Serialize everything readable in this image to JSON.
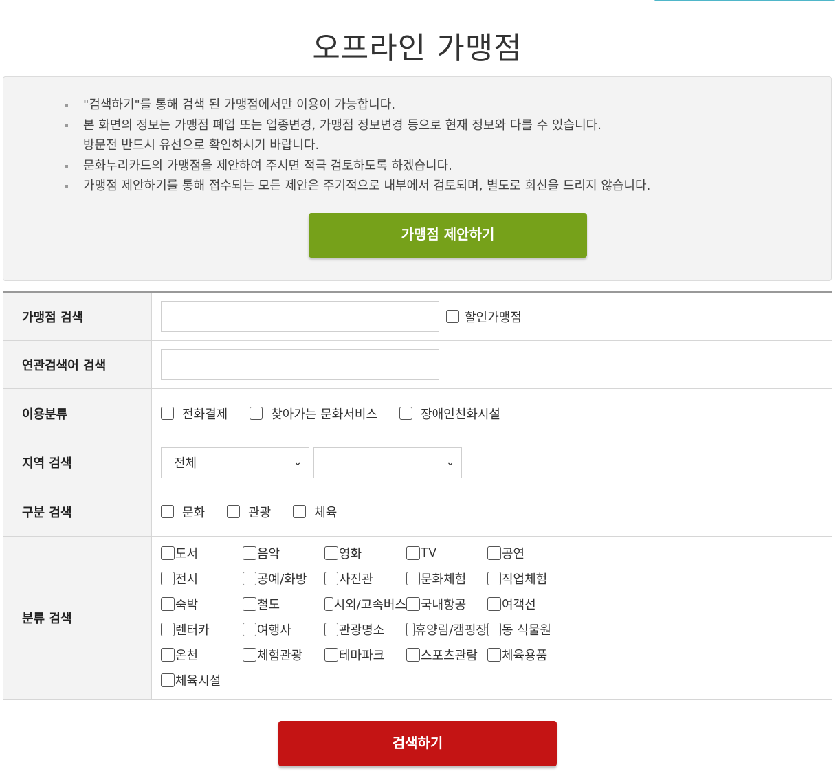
{
  "page": {
    "title": "오프라인 가맹점"
  },
  "notice": {
    "items": [
      {
        "lines": [
          "\"검색하기\"를 통해 검색 된 가맹점에서만 이용이 가능합니다."
        ]
      },
      {
        "lines": [
          "본 화면의 정보는 가맹점 폐업 또는 업종변경, 가맹점 정보변경 등으로 현재 정보와 다를 수 있습니다.",
          "방문전 반드시 유선으로 확인하시기 바랍니다."
        ]
      },
      {
        "lines": [
          "문화누리카드의 가맹점을 제안하여 주시면 적극 검토하도록 하겠습니다."
        ]
      },
      {
        "lines": [
          "가맹점 제안하기를 통해 접수되는 모든 제안은 주기적으로 내부에서 검토되며, 별도로 회신을 드리지 않습니다."
        ]
      }
    ],
    "suggest_button": "가맹점 제안하기"
  },
  "form": {
    "store_search": {
      "label": "가맹점 검색",
      "value": "",
      "discount_label": "할인가맹점",
      "discount_checked": false
    },
    "keyword_search": {
      "label": "연관검색어 검색",
      "value": ""
    },
    "usage_type": {
      "label": "이용분류",
      "options": [
        "전화결제",
        "찾아가는 문화서비스",
        "장애인친화시설"
      ]
    },
    "region_search": {
      "label": "지역 검색",
      "select1": "전체",
      "select2": ""
    },
    "division_search": {
      "label": "구분 검색",
      "options": [
        "문화",
        "관광",
        "체육"
      ]
    },
    "category_search": {
      "label": "분류 검색",
      "options": [
        "도서",
        "음악",
        "영화",
        "TV",
        "공연",
        "전시",
        "공예/화방",
        "사진관",
        "문화체험",
        "직업체험",
        "숙박",
        "철도",
        "시외/고속버스",
        "국내항공",
        "여객선",
        "렌터카",
        "여행사",
        "관광명소",
        "휴양림/캠핑장",
        "동 식물원",
        "온천",
        "체험관광",
        "테마파크",
        "스포츠관람",
        "체육용품",
        "체육시설"
      ]
    }
  },
  "search_button": "검색하기",
  "colors": {
    "suggest_button": "#76a11a",
    "search_button": "#c41414",
    "notice_bg": "#f3f3f3"
  }
}
